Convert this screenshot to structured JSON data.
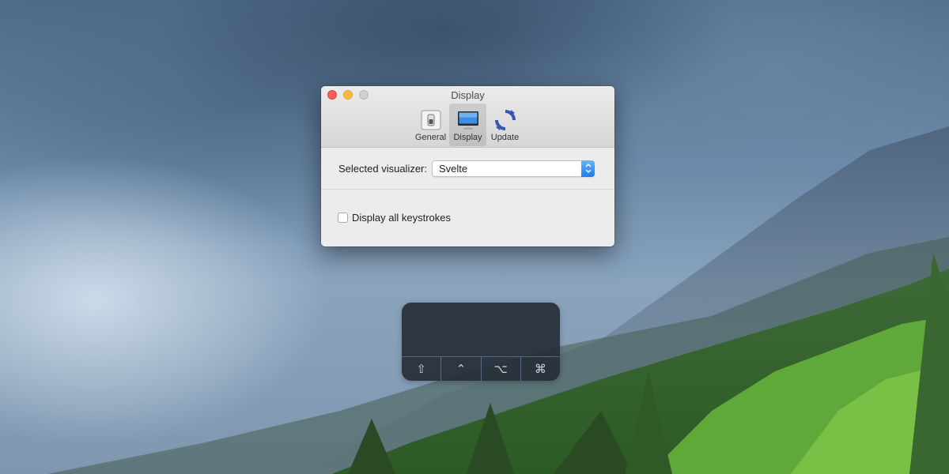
{
  "window": {
    "title": "Display",
    "toolbar": [
      {
        "label": "General",
        "icon": "general-switch-icon",
        "active": false
      },
      {
        "label": "Display",
        "icon": "display-monitor-icon",
        "active": true
      },
      {
        "label": "Update",
        "icon": "update-refresh-icon",
        "active": false
      }
    ]
  },
  "visualizer": {
    "label": "Selected visualizer:",
    "value": "Svelte"
  },
  "keystrokes": {
    "label": "Display all keystrokes",
    "checked": false
  },
  "hud": {
    "keys": [
      {
        "glyph": "⇧",
        "icon": "shift-key-icon"
      },
      {
        "glyph": "⌃",
        "icon": "control-key-icon"
      },
      {
        "glyph": "⌥",
        "icon": "option-key-icon"
      },
      {
        "glyph": "⌘",
        "icon": "command-key-icon"
      }
    ]
  },
  "colors": {
    "close": "#fc605b",
    "minimize": "#fdbc40",
    "zoom": "#d0d0d0",
    "select_accent": "#1e7cf2",
    "hud_background": "#262c36"
  }
}
